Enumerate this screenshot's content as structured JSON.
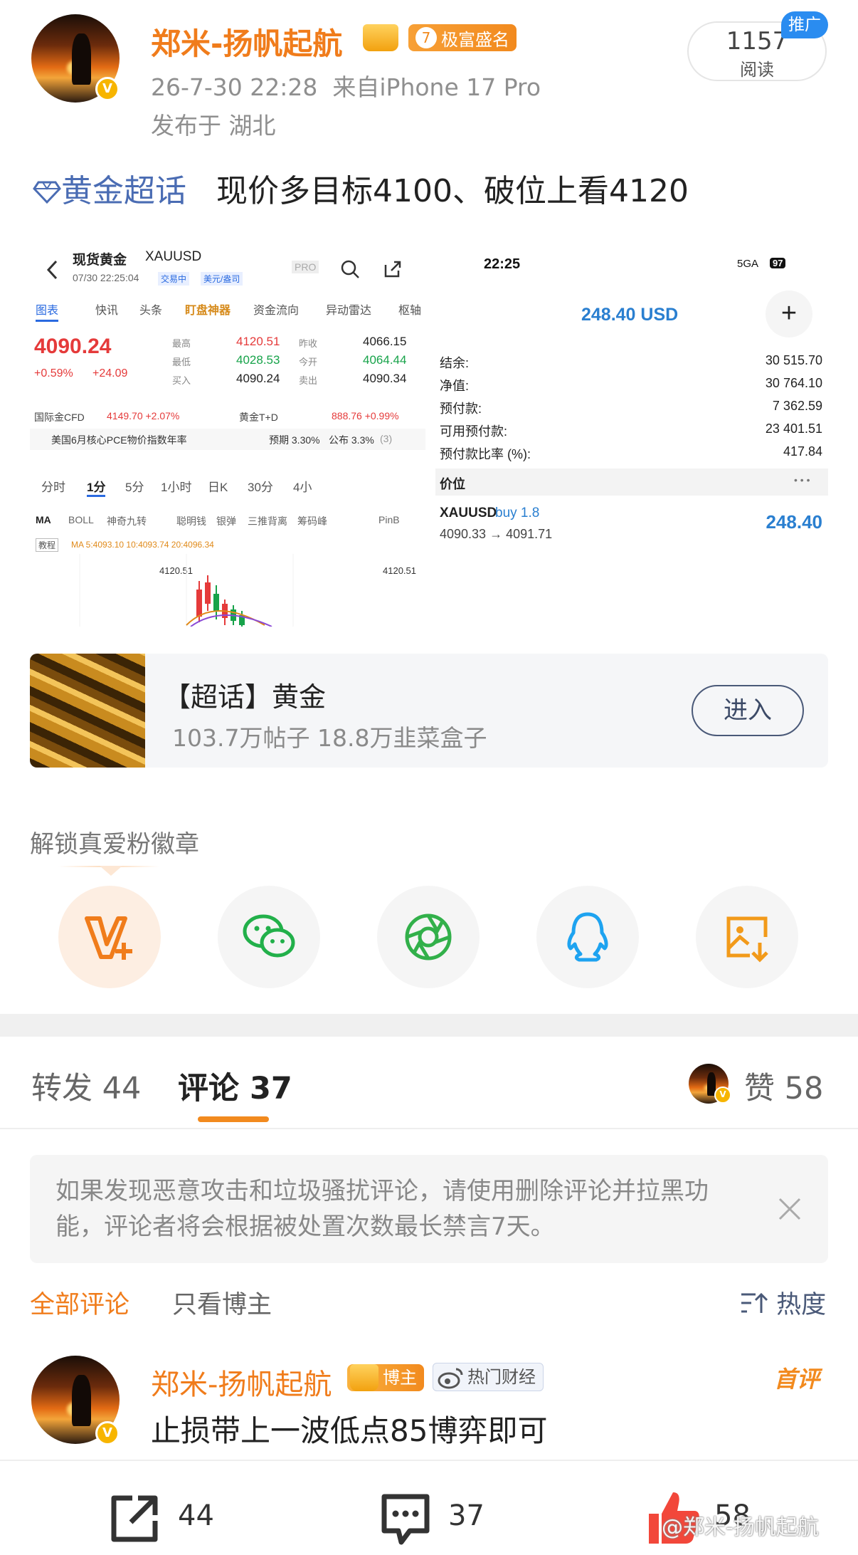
{
  "post": {
    "author": "郑米-扬帆起航",
    "level": "7",
    "badge": "极富盛名",
    "time": "26-7-30 22:28",
    "source": "来自iPhone 17 Pro",
    "location": "发布于 湖北",
    "read_count": "1157",
    "read_label": "阅读",
    "promo": "推广",
    "topic": "黄金超话",
    "text": "现价多目标4100、破位上看4120"
  },
  "img_left": {
    "title": "现货黄金",
    "symbol": "XAUUSD",
    "dt": "07/30 22:25:04",
    "status": "交易中",
    "unit": "美元/盎司",
    "pro": "PRO",
    "tabs": [
      "图表",
      "快讯",
      "头条",
      "盯盘神器",
      "资金流向",
      "异动雷达",
      "枢轴"
    ],
    "price": "4090.24",
    "change_pct": "+0.59%",
    "change": "+24.09",
    "high_label": "最高",
    "high": "4120.51",
    "low_label": "最低",
    "low": "4028.53",
    "buy_label": "买入",
    "buy": "4090.24",
    "prev_label": "昨收",
    "prev": "4066.15",
    "open_label": "今开",
    "open": "4064.44",
    "sell_label": "卖出",
    "sell": "4090.34",
    "cfd_label": "国际金CFD",
    "cfd": "4149.70 +2.07%",
    "td_label": "黄金T+D",
    "td": "888.76 +0.99%",
    "news": "美国6月核心PCE物价指数年率",
    "forecast": "预期 3.30%",
    "actual": "公布 3.3%",
    "news_count": "(3)",
    "periods": [
      "分时",
      "1分",
      "5分",
      "1小时",
      "日K",
      "30分",
      "4小"
    ],
    "indicators": [
      "MA",
      "BOLL",
      "神奇九转",
      "聪明钱",
      "银弹",
      "三推背离",
      "筹码峰",
      "PinB"
    ],
    "tutorial": "教程",
    "ma_line": "MA 5:4093.10 10:4093.74 20:4096.34",
    "chart_high": "4120.51",
    "chart_high_right": "4120.51"
  },
  "img_right": {
    "clock": "22:25",
    "net": "5GA",
    "battery": "97",
    "balance_usd": "248.40 USD",
    "plus": "+",
    "rows": [
      {
        "label": "结余:",
        "value": "30 515.70"
      },
      {
        "label": "净值:",
        "value": "30 764.10"
      },
      {
        "label": "预付款:",
        "value": "7 362.59"
      },
      {
        "label": "可用预付款:",
        "value": "23 401.51"
      },
      {
        "label": "预付款比率 (%):",
        "value": "417.84"
      }
    ],
    "section": "价位",
    "dots": "• • •",
    "pos_symbol": "XAUUSD",
    "pos_side": "buy 1.8",
    "pos_range": "4090.33 → 4091.71",
    "pos_profit": "248.40"
  },
  "topic_card": {
    "title": "【超话】黄金",
    "stats": "103.7万帖子 18.8万韭菜盒子",
    "enter": "进入"
  },
  "unlock_label": "解锁真爱粉徽章",
  "share_icons": [
    "v-plus-icon",
    "wechat-icon",
    "moments-icon",
    "qq-icon",
    "save-image-icon"
  ],
  "tabs": {
    "repost_label": "转发",
    "repost_count": "44",
    "comment_label": "评论",
    "comment_count": "37",
    "like_label": "赞",
    "like_count": "58"
  },
  "notice": "如果发现恶意攻击和垃圾骚扰评论，请使用删除评论并拉黑功能，评论者将会根据被处置次数最长禁言7天。",
  "filter": {
    "all": "全部评论",
    "host_only": "只看博主",
    "sort": "热度"
  },
  "comment": {
    "author": "郑米-扬帆起航",
    "role": "博主",
    "tag": "热门财经",
    "first": "首评",
    "text": "止损带上一波低点85博弈即可"
  },
  "bottom": {
    "repost": "44",
    "comment": "37",
    "like": "58",
    "watermark": "@郑米-扬帆起航"
  },
  "colors": {
    "accent": "#f07c1b",
    "link": "#4a6cb3",
    "tab_indicator": "#f28a1e",
    "up_red": "#e53a3a",
    "blue": "#2a8cf0"
  }
}
